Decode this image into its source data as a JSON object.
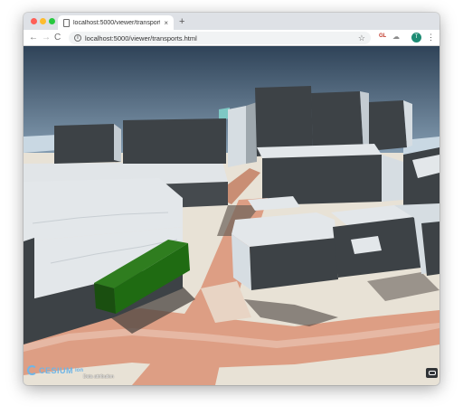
{
  "browser": {
    "tab": {
      "title": "localhost:5000/viewer/transports.html"
    },
    "new_tab_label": "+",
    "close_label": "×",
    "nav": {
      "back": "←",
      "forward": "→",
      "reload": "C"
    },
    "address_bar": {
      "url": "localhost:5000/viewer/transports.html"
    },
    "extensions": {
      "gl_label": "GL"
    },
    "profile_initial": "T",
    "menu_label": "⋮"
  },
  "viewer": {
    "logo_text": "CESIUM",
    "logo_suffix": "ion",
    "attribution_link": "Data attribution",
    "icons": [
      "cesium-logo-icon",
      "vr-icon"
    ],
    "colors": {
      "sky_top": "#2f4358",
      "sky_bottom": "#8fa8bd",
      "ground": "#e8e2d6",
      "road": "#dd9e84",
      "building_dark": "#3d4246",
      "building_light": "#e3e7ea",
      "transport_block": "#1f6b12"
    }
  }
}
